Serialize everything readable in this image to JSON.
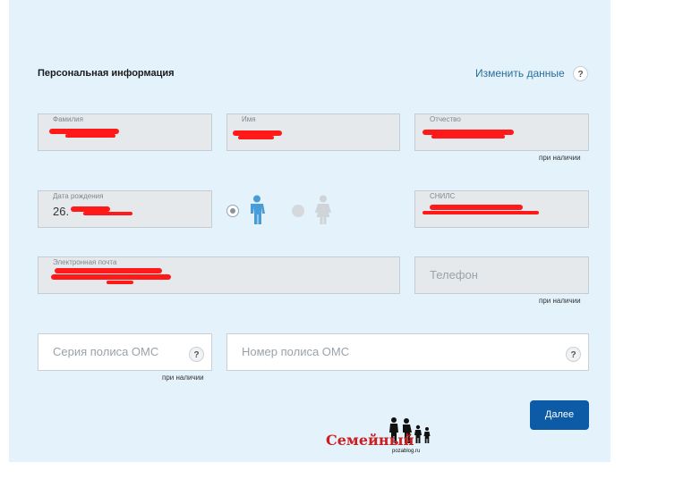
{
  "section": {
    "title": "Персональная информация",
    "edit_link": "Изменить данные",
    "help": "?"
  },
  "fields": {
    "surname": {
      "label": "Фамилия"
    },
    "name": {
      "label": "Имя"
    },
    "patronymic": {
      "label": "Отчество",
      "hint": "при наличии"
    },
    "birth_date": {
      "label": "Дата рождения",
      "value_visible": "26."
    },
    "snils": {
      "label": "СНИЛС"
    },
    "email": {
      "label": "Электронная почта"
    },
    "phone": {
      "placeholder": "Телефон",
      "hint": "при наличии"
    },
    "oms_series": {
      "placeholder": "Серия полиса ОМС",
      "hint": "при наличии",
      "help": "?"
    },
    "oms_number": {
      "placeholder": "Номер полиса ОМС",
      "help": "?"
    }
  },
  "gender": {
    "selected": "male",
    "options": [
      "male",
      "female"
    ]
  },
  "buttons": {
    "next": "Далее"
  },
  "watermark": {
    "text": "Семейный",
    "sub": "pozablog.ru"
  },
  "colors": {
    "panel": "#e3f2fb",
    "accent": "#0d5aa6",
    "link": "#2a6f9b",
    "redaction": "#ff1a1a"
  }
}
